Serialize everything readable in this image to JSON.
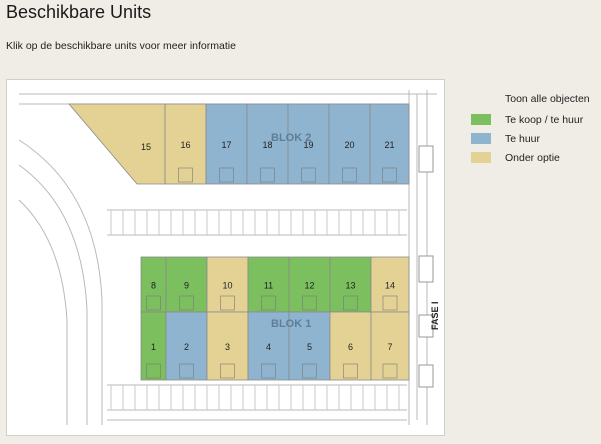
{
  "header": {
    "title": "Beschikbare Units",
    "subtitle": "Klik op de beschikbare units voor meer informatie"
  },
  "legend": {
    "title": "Toon alle objecten",
    "items": [
      {
        "label": "Te koop / te huur",
        "color": "#7bbf5e"
      },
      {
        "label": "Te huur",
        "color": "#8fb4cf"
      },
      {
        "label": "Onder optie",
        "color": "#e3d294"
      }
    ]
  },
  "plan": {
    "blok2_label": "BLOK 2",
    "blok1_label": "BLOK 1",
    "fase_label": "FASE I",
    "units": [
      {
        "number": "15",
        "status": "Onder optie"
      },
      {
        "number": "16",
        "status": "Onder optie"
      },
      {
        "number": "17",
        "status": "Te huur"
      },
      {
        "number": "18",
        "status": "Te huur"
      },
      {
        "number": "19",
        "status": "Te huur"
      },
      {
        "number": "20",
        "status": "Te huur"
      },
      {
        "number": "21",
        "status": "Te huur"
      },
      {
        "number": "8",
        "status": "Te koop / te huur"
      },
      {
        "number": "9",
        "status": "Te koop / te huur"
      },
      {
        "number": "10",
        "status": "Onder optie"
      },
      {
        "number": "11",
        "status": "Te koop / te huur"
      },
      {
        "number": "12",
        "status": "Te koop / te huur"
      },
      {
        "number": "13",
        "status": "Te koop / te huur"
      },
      {
        "number": "14",
        "status": "Onder optie"
      },
      {
        "number": "1",
        "status": "Te koop / te huur"
      },
      {
        "number": "2",
        "status": "Te huur"
      },
      {
        "number": "3",
        "status": "Onder optie"
      },
      {
        "number": "4",
        "status": "Te huur"
      },
      {
        "number": "5",
        "status": "Te huur"
      },
      {
        "number": "6",
        "status": "Onder optie"
      },
      {
        "number": "7",
        "status": "Onder optie"
      }
    ]
  }
}
